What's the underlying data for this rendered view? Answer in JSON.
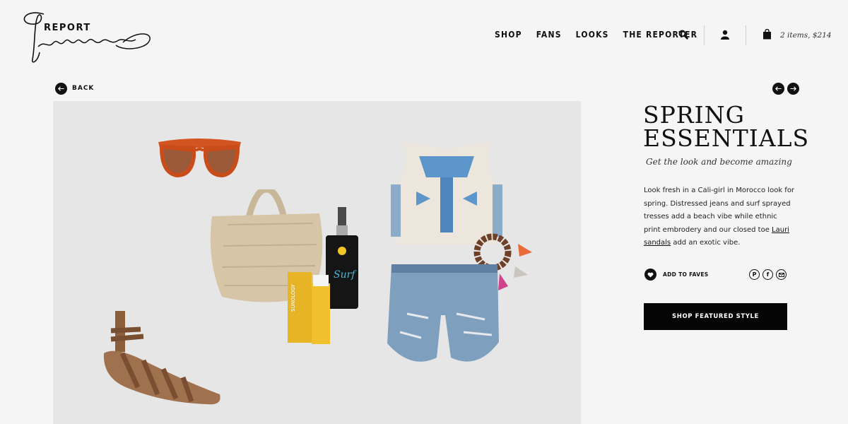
{
  "brand": {
    "logo_text": "REPORT",
    "logo_script": "Signature"
  },
  "nav": {
    "items": [
      "SHOP",
      "FANS",
      "LOOKS",
      "THE REPORTER"
    ]
  },
  "header": {
    "cart_text": "2 items, $214"
  },
  "icons": {
    "search": "search-icon",
    "account": "user-icon",
    "cart": "shopping-bag-icon",
    "back": "arrow-left-icon",
    "prev": "arrow-left-icon",
    "next": "arrow-right-icon",
    "fave": "heart-icon",
    "pinterest": "pinterest-icon",
    "facebook": "facebook-icon",
    "email": "email-icon"
  },
  "back": {
    "label": "BACK"
  },
  "look": {
    "title_line1": "SPRING",
    "title_line2": "ESSENTIALS",
    "subtitle": "Get the look and become amazing",
    "description_before": "Look fresh in a Cali-girl in Morocco look for spring. Distressed jeans and surf sprayed tresses add a beach vibe while ethnic print embrodery and our closed toe ",
    "description_link": "Lauri sandals",
    "description_after": " add an exotic vibe.",
    "fave_label": "ADD TO FAVES",
    "share_labels": {
      "pinterest": "P",
      "facebook": "f"
    },
    "shop_button": "SHOP FEATURED STYLE"
  },
  "colors": {
    "accent": "#111111",
    "panel_bg": "#e6e6e6",
    "page_bg": "#f5f5f5"
  }
}
